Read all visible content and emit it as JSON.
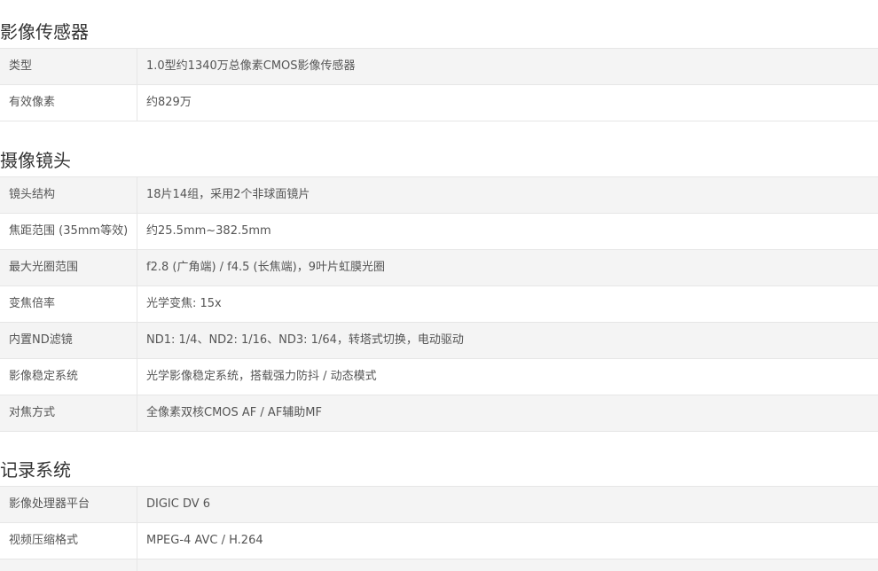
{
  "sections": [
    {
      "title": "影像传感器",
      "rows": [
        {
          "label": "类型",
          "value": "1.0型约1340万总像素CMOS影像传感器"
        },
        {
          "label": "有效像素",
          "value": "约829万"
        }
      ]
    },
    {
      "title": "摄像镜头",
      "rows": [
        {
          "label": "镜头结构",
          "value": "18片14组，采用2个非球面镜片"
        },
        {
          "label": "焦距范围 (35mm等效)",
          "value": "约25.5mm~382.5mm"
        },
        {
          "label": "最大光圈范围",
          "value": "f2.8 (广角端) / f4.5 (长焦端)，9叶片虹膜光圈"
        },
        {
          "label": "变焦倍率",
          "value": "光学变焦: 15x"
        },
        {
          "label": "内置ND滤镜",
          "value": "ND1: 1/4、ND2: 1/16、ND3: 1/64，转塔式切换，电动驱动"
        },
        {
          "label": "影像稳定系统",
          "value": "光学影像稳定系统，搭载强力防抖 / 动态模式"
        },
        {
          "label": "对焦方式",
          "value": "全像素双核CMOS AF / AF辅助MF"
        }
      ]
    },
    {
      "title": "记录系统",
      "rows": [
        {
          "label": "影像处理器平台",
          "value": "DIGIC DV 6"
        },
        {
          "label": "视频压缩格式",
          "value": "MPEG-4 AVC / H.264"
        },
        {
          "label": "",
          "value": ""
        }
      ]
    }
  ]
}
